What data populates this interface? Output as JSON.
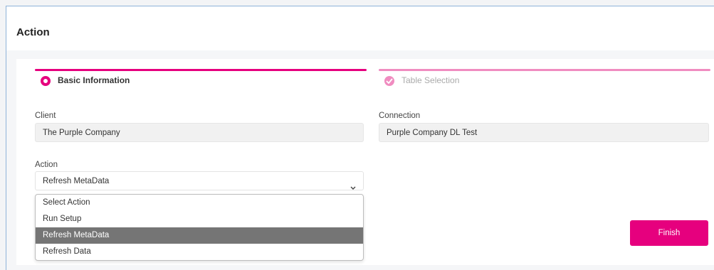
{
  "header": {
    "title": "Action"
  },
  "steps": [
    {
      "label": "Basic Information",
      "state": "active"
    },
    {
      "label": "Table Selection",
      "state": "complete"
    }
  ],
  "client": {
    "label": "Client",
    "value": "The Purple Company"
  },
  "connection": {
    "label": "Connection",
    "value": "Purple Company DL Test"
  },
  "action": {
    "label": "Action",
    "selected": "Refresh MetaData",
    "options": [
      "Select Action",
      "Run Setup",
      "Refresh MetaData",
      "Refresh Data"
    ],
    "highlighted_index": 2
  },
  "finish_label": "Finish",
  "colors": {
    "accent": "#e6007e",
    "accent_light": "#f08cc0",
    "highlight": "#757575"
  }
}
